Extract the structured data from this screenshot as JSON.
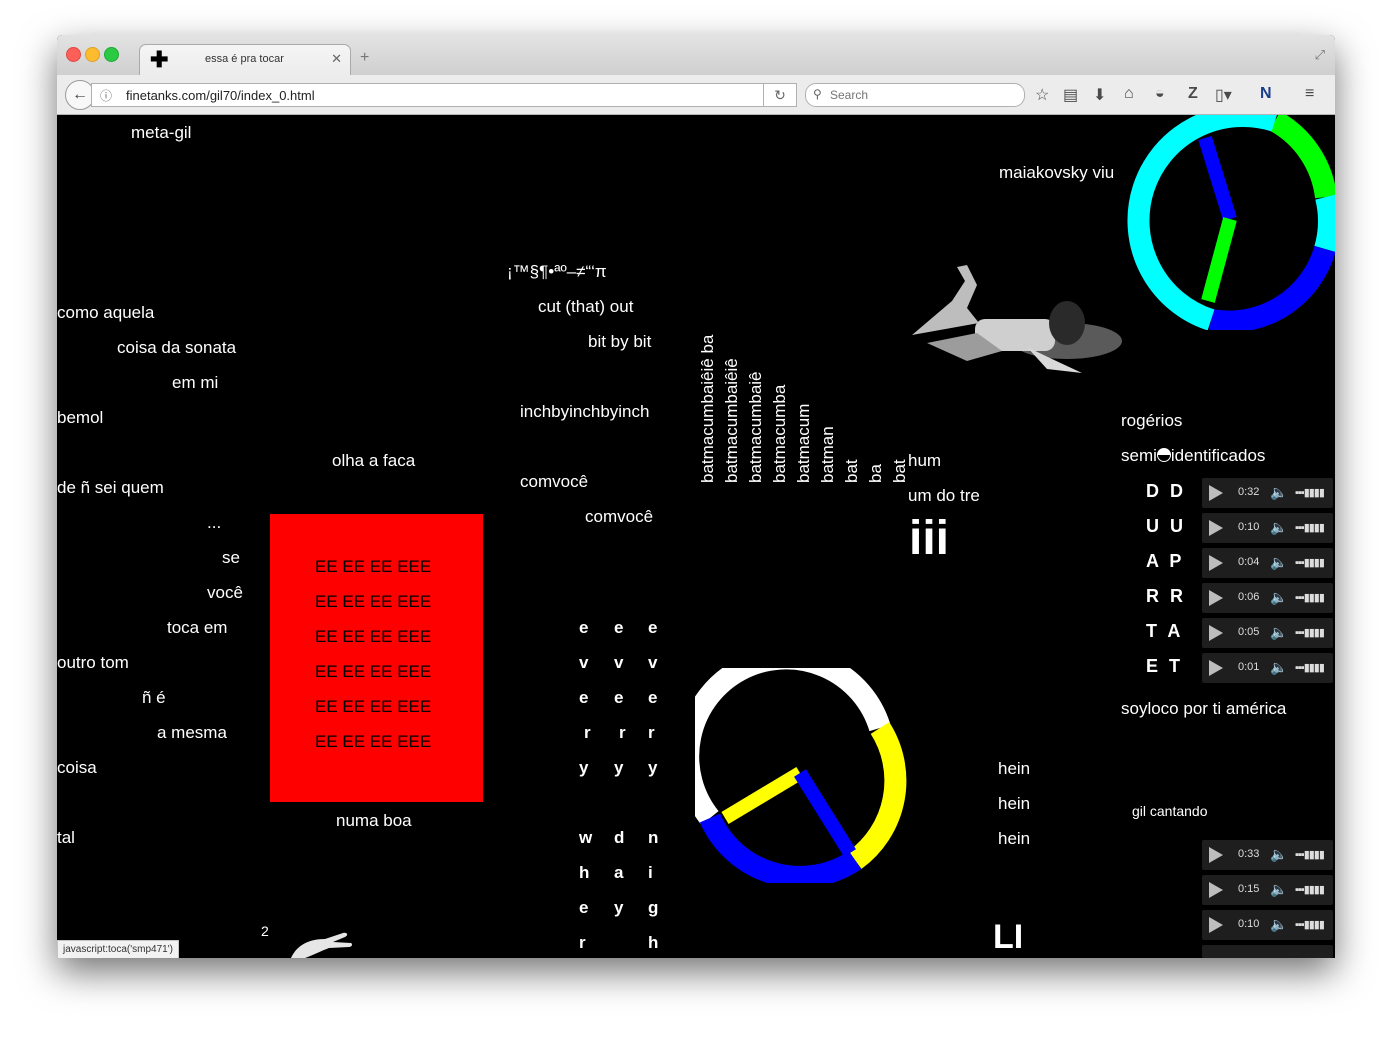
{
  "browser": {
    "tab_title": "essa é pra tocar",
    "url": "finetanks.com/gil70/index_0.html",
    "search_placeholder": "Search",
    "status_text": "javascript:toca('smp471')"
  },
  "page": {
    "meta_gil": "meta-gil",
    "maiakovsky": "maiakovsky viu",
    "poem_left": [
      "como aquela",
      "coisa da sonata",
      "em mi",
      "bemol",
      "de ñ sei quem",
      "...",
      "se",
      "você",
      "toca em",
      "outro tom",
      "ñ é",
      "a mesma",
      "coisa",
      "tal"
    ],
    "olha_a_faca": "olha a faca",
    "numa_boa": "numa boa",
    "ee_lines": [
      "EE EE EE EEE",
      "EE EE EE EEE",
      "EE EE EE EEE",
      "EE EE EE EEE",
      "EE EE EE EEE",
      "EE EE EE EEE"
    ],
    "symbols": "¡™§¶•ªº–≠“‘π",
    "cut_out": "cut (that) out",
    "bit_by_bit": "bit by bit",
    "inch": "inchbyinchbyinch",
    "comvoce": "comvocê",
    "every_col1": [
      "e",
      "v",
      "e",
      "r",
      "y",
      "",
      "w",
      "h",
      "e",
      "r"
    ],
    "every_col2": [
      "e",
      "v",
      "e",
      "r",
      "y",
      "",
      "d",
      "a",
      "y",
      ""
    ],
    "every_col3": [
      "e",
      "v",
      "e",
      "r",
      "y",
      "",
      "n",
      "i",
      "g",
      "h"
    ],
    "batmacumba": [
      "batmacumbaiêiê ba",
      "batmacumbaiêiê",
      "batmacumbaiê",
      "batmacumba",
      "batmacum",
      "batman",
      "bat",
      "ba",
      "bat"
    ],
    "hum": "hum",
    "um_do_tre": "um do tre",
    "iii": "iii",
    "hein": [
      "hein",
      "hein",
      "hein"
    ],
    "li": "LI",
    "number_2": "2",
    "rogerios": "rogérios",
    "semi": "semi",
    "identificados": "identificados",
    "letter_pairs": [
      "D D",
      "U U",
      "A P",
      "R R",
      "T A",
      "E T"
    ],
    "audio_times_top": [
      "0:32",
      "0:10",
      "0:04",
      "0:06",
      "0:05",
      "0:01"
    ],
    "soyloco": "soyloco por ti américa",
    "gil_cantando": "gil cantando",
    "audio_times_bottom": [
      "0:33",
      "0:15",
      "0:10"
    ]
  },
  "colors": {
    "red_box": "#ff0000",
    "clock_top": [
      "#00ffff",
      "#00ff00",
      "#0000ff"
    ],
    "clock_bottom": [
      "#ffffff",
      "#ffff00",
      "#0000ff"
    ]
  }
}
